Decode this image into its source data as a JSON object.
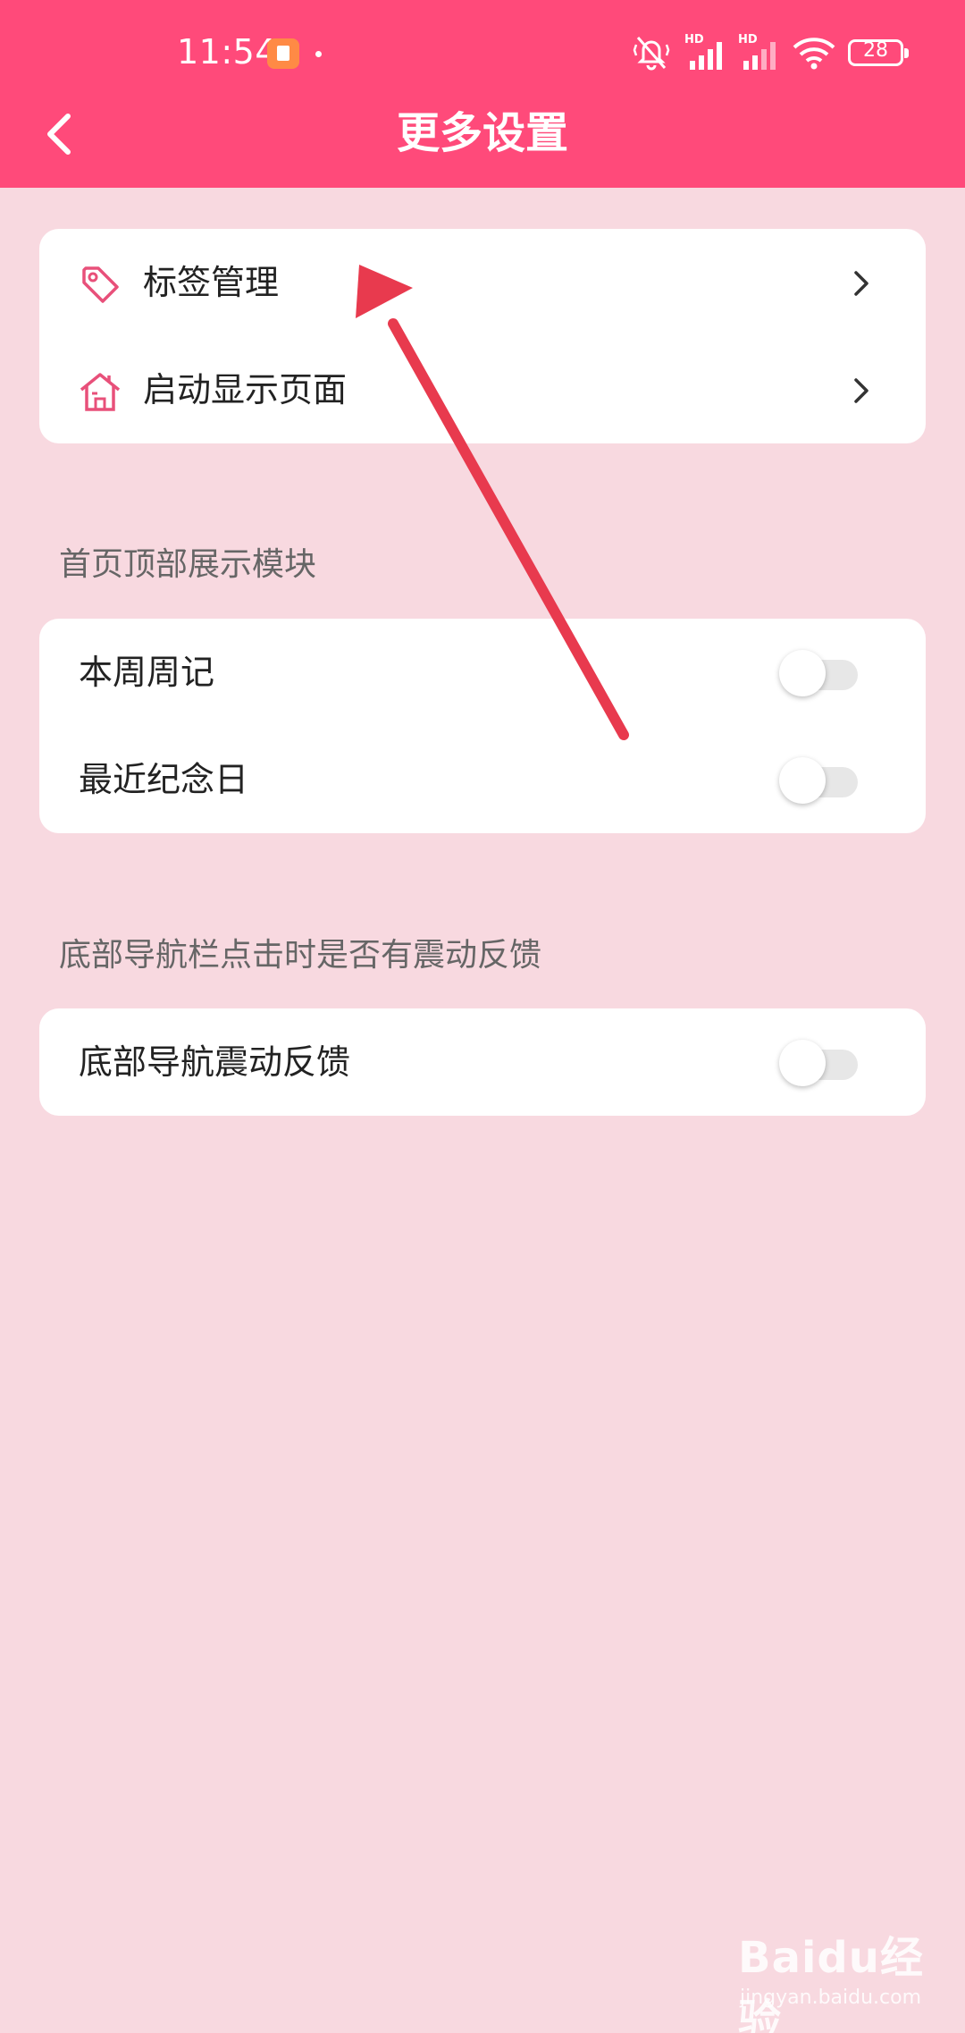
{
  "status_bar": {
    "time": "11:54",
    "battery": "28",
    "signal_label": "HD"
  },
  "header": {
    "title": "更多设置",
    "back_icon": "chevron-left-icon"
  },
  "general_card": {
    "items": [
      {
        "label": "标签管理",
        "icon": "tag-icon"
      },
      {
        "label": "启动显示页面",
        "icon": "house-icon"
      }
    ]
  },
  "home_section": {
    "title": "首页顶部展示模块",
    "items": [
      {
        "label": "本周周记",
        "enabled": false
      },
      {
        "label": "最近纪念日",
        "enabled": false
      }
    ]
  },
  "nav_section": {
    "title": "底部导航栏点击时是否有震动反馈",
    "items": [
      {
        "label": "底部导航震动反馈",
        "enabled": false
      }
    ]
  },
  "watermark": {
    "brand": "Baidu经验",
    "url": "jingyan.baidu.com"
  },
  "colors": {
    "header": "#ff4a7a",
    "background": "#f8d9e0",
    "icon_accent": "#e8507a",
    "arrow": "#e83a4e"
  }
}
